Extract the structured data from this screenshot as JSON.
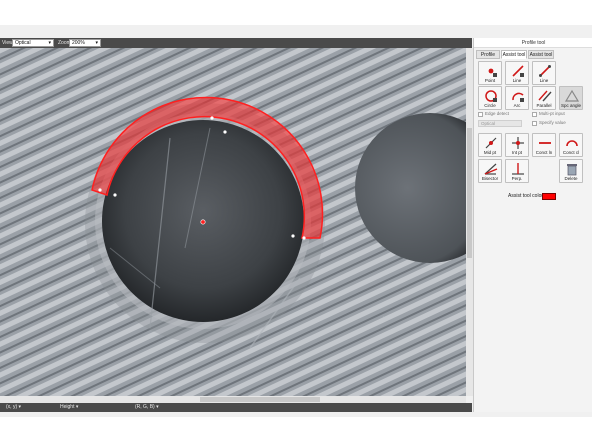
{
  "window": {
    "title": "Profile tool",
    "minimize": "—",
    "restore": "❐",
    "close": "✕"
  },
  "toolbar": {
    "view_label": "View",
    "view_value": "Optical",
    "zoom_label": "Zoom",
    "zoom_value": "200%"
  },
  "panel": {
    "tabs": [
      {
        "label": "Profile line"
      },
      {
        "label": "Assist tool 1"
      },
      {
        "label": "Assist tool 2"
      }
    ],
    "tools_row1": [
      {
        "label": "Point"
      },
      {
        "label": "Line"
      },
      {
        "label": "Line"
      }
    ],
    "tools_row2": [
      {
        "label": "Circle"
      },
      {
        "label": "Arc"
      },
      {
        "label": "Parallel"
      },
      {
        "label": "Spc angle"
      }
    ],
    "options": {
      "edge_detect": "Edge detect",
      "multi_pt": "Multi-pt input",
      "specify_value": "Specify value",
      "field_placeholder": "Optical"
    },
    "tools_row3": [
      {
        "label": "Mid pt"
      },
      {
        "label": "Int pt"
      },
      {
        "label": "Conct ln"
      },
      {
        "label": "Conct cl"
      }
    ],
    "tools_row4": [
      {
        "label": "Bisector"
      },
      {
        "label": "Perp."
      },
      {
        "label": "Delete"
      }
    ],
    "assist_color_label": "Assist tool color",
    "assist_color": "#ff0000"
  },
  "statusbar": {
    "xy": "(x, y)",
    "height": "Height",
    "rgb": "(R, G, B)"
  },
  "overlay": {
    "arc_color": "#ff2020",
    "icon_accent": "#d01818"
  }
}
